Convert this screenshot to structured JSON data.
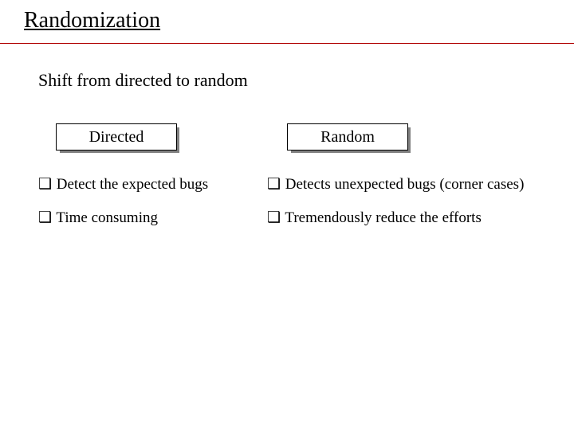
{
  "title": "Randomization",
  "subtitle": "Shift from directed to random",
  "bullet_glyph": "❑",
  "boxes": {
    "left": "Directed",
    "right": "Random"
  },
  "left_items": [
    "Detect the expected bugs",
    "Time consuming"
  ],
  "right_items": [
    "Detects unexpected bugs (corner cases)",
    "Tremendously reduce the efforts"
  ]
}
